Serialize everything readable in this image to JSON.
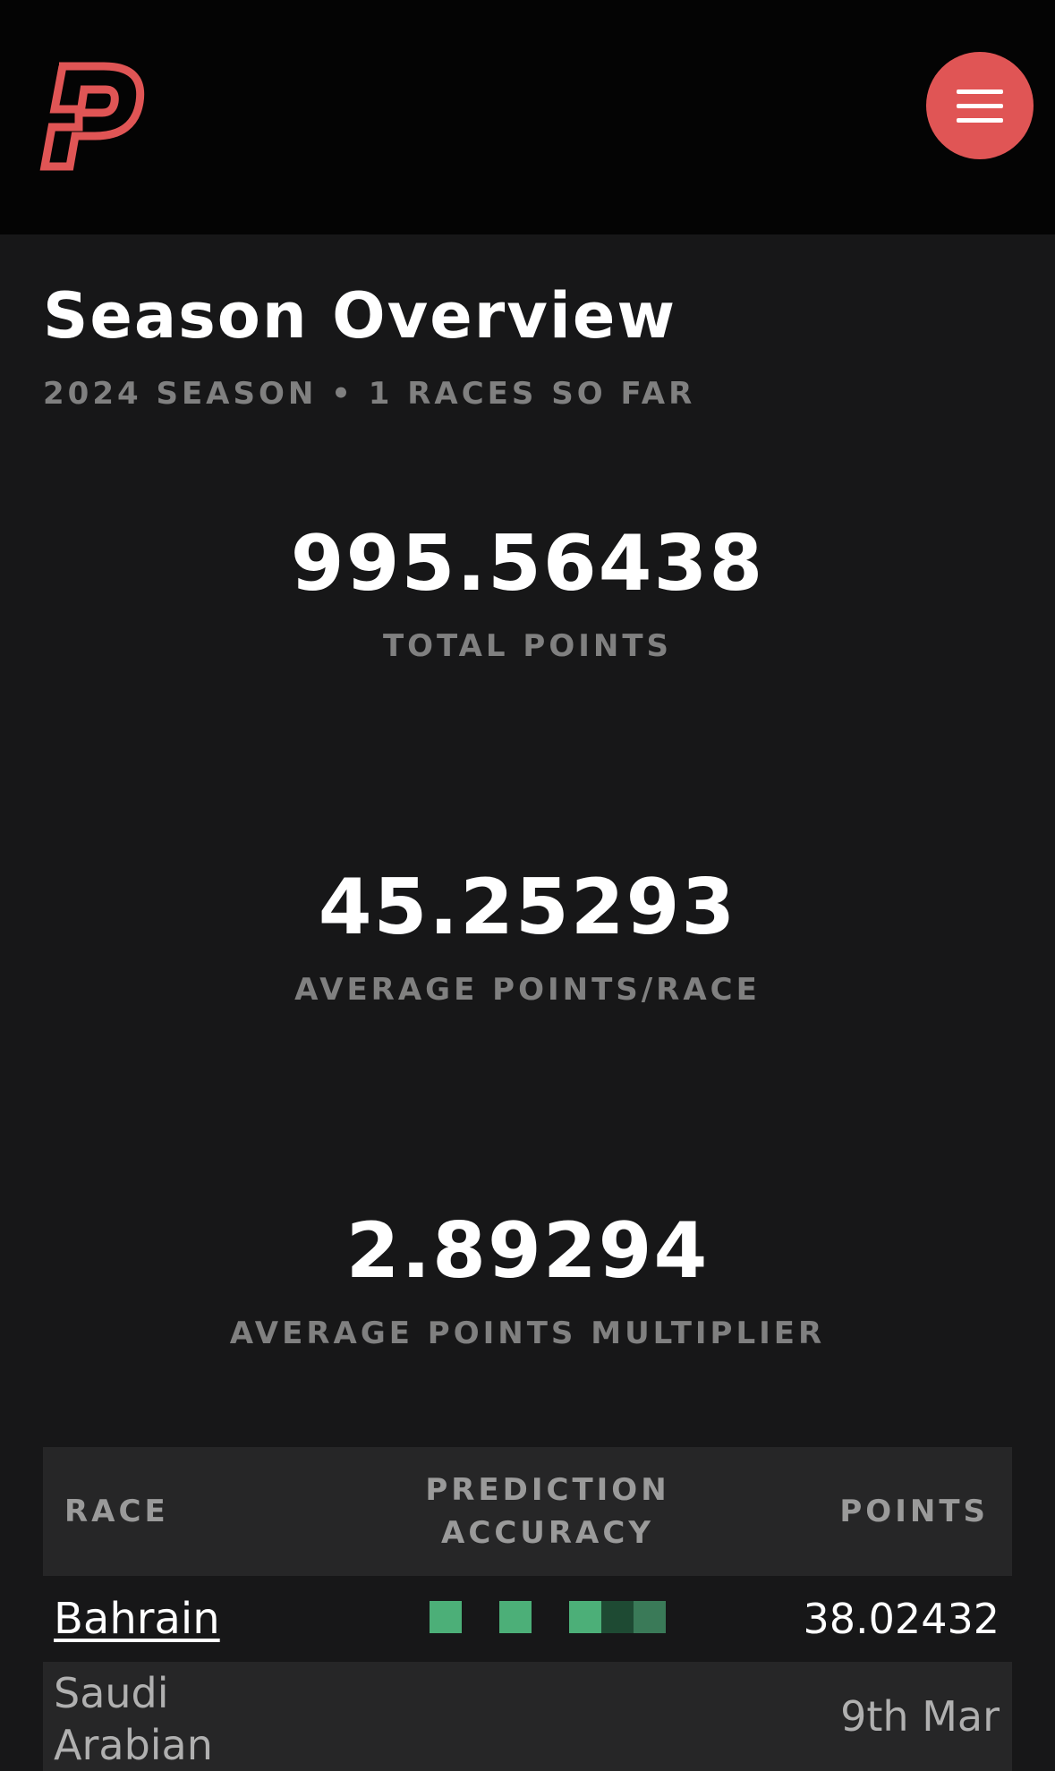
{
  "header": {
    "logo_icon": "brand-p-logo-icon",
    "menu_icon": "hamburger-menu-icon",
    "accent_color": "#e05555"
  },
  "overview": {
    "title": "Season Overview",
    "subtitle": "2024 SEASON • 1 RACES SO FAR"
  },
  "stats": [
    {
      "value": "995.56438",
      "label": "TOTAL POINTS"
    },
    {
      "value": "45.25293",
      "label": "AVERAGE POINTS/RACE"
    },
    {
      "value": "2.89294",
      "label": "AVERAGE POINTS MULTIPLIER"
    }
  ],
  "table": {
    "headers": {
      "race": "RACE",
      "accuracy_line1": "PREDICTION",
      "accuracy_line2": "ACCURACY",
      "points": "POINTS"
    },
    "rows": [
      {
        "race": "Bahrain",
        "points": "38.02432",
        "accuracy_colors": [
          "#4caf78",
          "#4caf78",
          "#4caf78",
          "#1e4a33",
          "#3a7a58"
        ]
      },
      {
        "race_line1": "Saudi",
        "race_line2": "Arabian",
        "date": "9th Mar"
      }
    ]
  }
}
